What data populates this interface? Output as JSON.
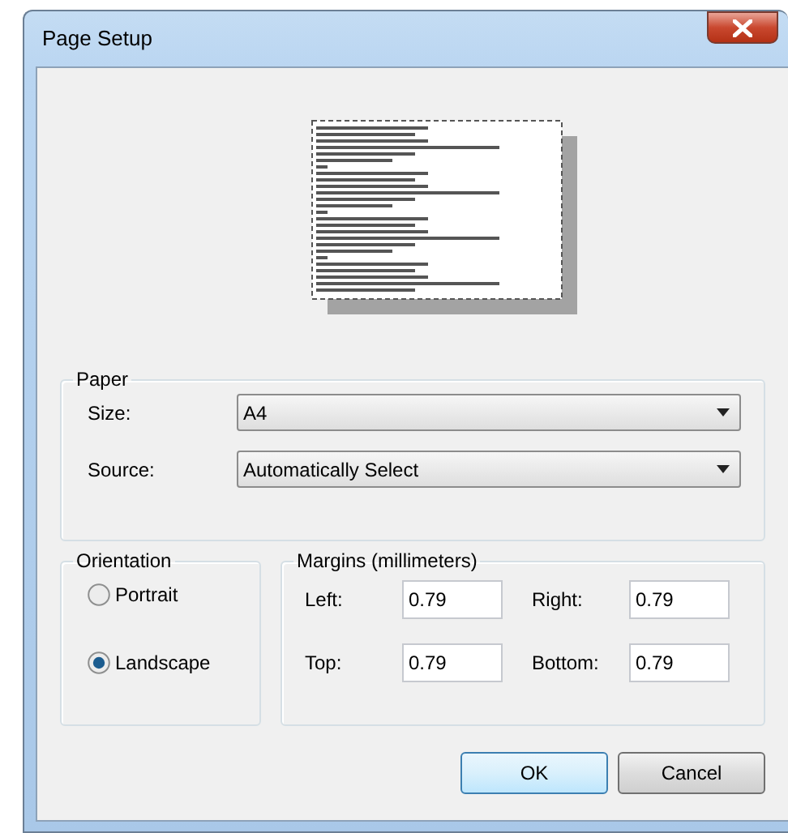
{
  "window": {
    "title": "Page Setup"
  },
  "paper": {
    "legend": "Paper",
    "fields": [
      {
        "label": "Size:",
        "value": "A4"
      },
      {
        "label": "Source:",
        "value": "Automatically Select"
      }
    ]
  },
  "orientation": {
    "legend": "Orientation",
    "options": [
      {
        "label": "Portrait",
        "selected": false
      },
      {
        "label": "Landscape",
        "selected": true
      }
    ]
  },
  "margins": {
    "legend": "Margins (millimeters)",
    "fields": [
      {
        "label": "Left:",
        "value": "0.79"
      },
      {
        "label": "Right:",
        "value": "0.79"
      },
      {
        "label": "Top:",
        "value": "0.79"
      },
      {
        "label": "Bottom:",
        "value": "0.79"
      }
    ]
  },
  "buttons": [
    {
      "label": "OK",
      "default": true
    },
    {
      "label": "Cancel",
      "default": false
    }
  ]
}
